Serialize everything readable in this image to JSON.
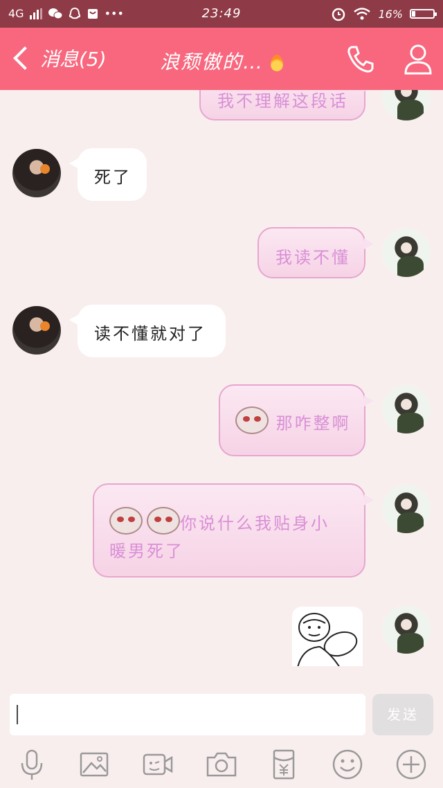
{
  "status_bar": {
    "network": "4G",
    "time": "23:49",
    "battery": "16%"
  },
  "header": {
    "back_label": "消息(5)",
    "title": "浪颓傲的…"
  },
  "messages": [
    {
      "side": "me",
      "text": "我不理解这段话"
    },
    {
      "side": "friend",
      "text": "死了"
    },
    {
      "side": "me",
      "text": "我读不懂"
    },
    {
      "side": "friend",
      "text": "读不懂就对了"
    },
    {
      "side": "me",
      "text": "那咋整啊"
    },
    {
      "side": "me",
      "text_line1": "你说什么我贴身小",
      "text_line2": "暖男死了"
    },
    {
      "side": "me",
      "type": "sticker",
      "icon": "meme-sticker"
    }
  ],
  "input": {
    "value": "",
    "send_label": "发送"
  },
  "toolbar": [
    "mic-icon",
    "image-icon",
    "video-icon",
    "camera-icon",
    "red-packet-icon",
    "emoji-icon",
    "plus-icon"
  ],
  "colors": {
    "header": "#f8677e",
    "status": "#8f3a47",
    "background": "#f9eeee",
    "my_bubble_text": "#d98fd6"
  }
}
